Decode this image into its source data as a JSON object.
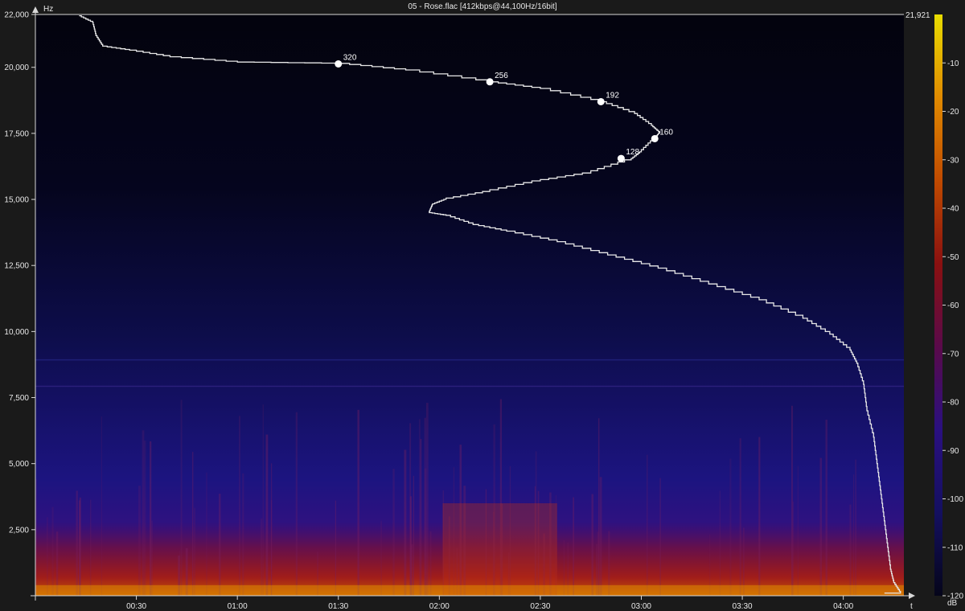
{
  "window_title": "05 - Rose.flac [412kbps@44,100Hz/16bit]",
  "chart_data": {
    "type": "heatmap",
    "title": "05 - Rose.flac [412kbps@44,100Hz/16bit]",
    "ylabel": "Hz",
    "xlabel": "t",
    "colorbar_label": "dB",
    "ylim": [
      0,
      22000
    ],
    "xlim_seconds": [
      0,
      258
    ],
    "y_max_label": "21,921",
    "y_ticks": [
      {
        "value": 22000,
        "label": "22,000"
      },
      {
        "value": 20000,
        "label": "20,000"
      },
      {
        "value": 17500,
        "label": "17,500"
      },
      {
        "value": 15000,
        "label": "15,000"
      },
      {
        "value": 12500,
        "label": "12,500"
      },
      {
        "value": 10000,
        "label": "10,000"
      },
      {
        "value": 7500,
        "label": "7,500"
      },
      {
        "value": 5000,
        "label": "5,000"
      },
      {
        "value": 2500,
        "label": "2,500"
      }
    ],
    "x_ticks": [
      {
        "value": 30,
        "label": "00:30"
      },
      {
        "value": 60,
        "label": "01:00"
      },
      {
        "value": 90,
        "label": "01:30"
      },
      {
        "value": 120,
        "label": "02:00"
      },
      {
        "value": 150,
        "label": "02:30"
      },
      {
        "value": 180,
        "label": "03:00"
      },
      {
        "value": 210,
        "label": "03:30"
      },
      {
        "value": 240,
        "label": "04:00"
      }
    ],
    "colorbar_range": [
      -120,
      0
    ],
    "colorbar_ticks": [
      {
        "value": -10,
        "label": "-10"
      },
      {
        "value": -20,
        "label": "-20"
      },
      {
        "value": -30,
        "label": "-30"
      },
      {
        "value": -40,
        "label": "-40"
      },
      {
        "value": -50,
        "label": "-50"
      },
      {
        "value": -60,
        "label": "-60"
      },
      {
        "value": -70,
        "label": "-70"
      },
      {
        "value": -80,
        "label": "-80"
      },
      {
        "value": -90,
        "label": "-90"
      },
      {
        "value": -100,
        "label": "-100"
      },
      {
        "value": -110,
        "label": "-110"
      },
      {
        "value": -120,
        "label": "-120"
      }
    ],
    "colorbar_colors": [
      "#e8dc00",
      "#e08a00",
      "#c04a00",
      "#8a1010",
      "#5a0a4a",
      "#2a1080",
      "#141060",
      "#05051a"
    ],
    "cutoff_curve": [
      {
        "t": 13,
        "hz": 21950
      },
      {
        "t": 17,
        "hz": 21700
      },
      {
        "t": 18,
        "hz": 21200
      },
      {
        "t": 20,
        "hz": 20800
      },
      {
        "t": 28,
        "hz": 20650
      },
      {
        "t": 40,
        "hz": 20400
      },
      {
        "t": 60,
        "hz": 20200
      },
      {
        "t": 90,
        "hz": 20150
      },
      {
        "t": 110,
        "hz": 19900
      },
      {
        "t": 135,
        "hz": 19450
      },
      {
        "t": 150,
        "hz": 19200
      },
      {
        "t": 168,
        "hz": 18700
      },
      {
        "t": 178,
        "hz": 18250
      },
      {
        "t": 183,
        "hz": 17800
      },
      {
        "t": 185.5,
        "hz": 17520
      },
      {
        "t": 184,
        "hz": 17300
      },
      {
        "t": 180,
        "hz": 16800
      },
      {
        "t": 177,
        "hz": 16500
      },
      {
        "t": 165,
        "hz": 16000
      },
      {
        "t": 150,
        "hz": 15700
      },
      {
        "t": 135,
        "hz": 15300
      },
      {
        "t": 122,
        "hz": 15000
      },
      {
        "t": 118,
        "hz": 14800
      },
      {
        "t": 117,
        "hz": 14500
      },
      {
        "t": 122,
        "hz": 14400
      },
      {
        "t": 130,
        "hz": 14050
      },
      {
        "t": 140,
        "hz": 13800
      },
      {
        "t": 155,
        "hz": 13400
      },
      {
        "t": 170,
        "hz": 12900
      },
      {
        "t": 185,
        "hz": 12400
      },
      {
        "t": 200,
        "hz": 11800
      },
      {
        "t": 215,
        "hz": 11200
      },
      {
        "t": 228,
        "hz": 10500
      },
      {
        "t": 236,
        "hz": 9900
      },
      {
        "t": 242,
        "hz": 9300
      },
      {
        "t": 244,
        "hz": 8800
      },
      {
        "t": 246,
        "hz": 8000
      },
      {
        "t": 247,
        "hz": 7000
      },
      {
        "t": 249,
        "hz": 6000
      },
      {
        "t": 250,
        "hz": 5000
      },
      {
        "t": 251,
        "hz": 4000
      },
      {
        "t": 252,
        "hz": 3000
      },
      {
        "t": 253,
        "hz": 2000
      },
      {
        "t": 254,
        "hz": 1000
      },
      {
        "t": 255,
        "hz": 500
      },
      {
        "t": 257,
        "hz": 100
      }
    ],
    "bitrate_markers": [
      {
        "t": 90,
        "hz": 20130,
        "label": "320"
      },
      {
        "t": 135,
        "hz": 19450,
        "label": "256"
      },
      {
        "t": 168,
        "hz": 18700,
        "label": "192"
      },
      {
        "t": 184,
        "hz": 17300,
        "label": "160"
      },
      {
        "t": 174,
        "hz": 16550,
        "label": "128"
      }
    ]
  }
}
